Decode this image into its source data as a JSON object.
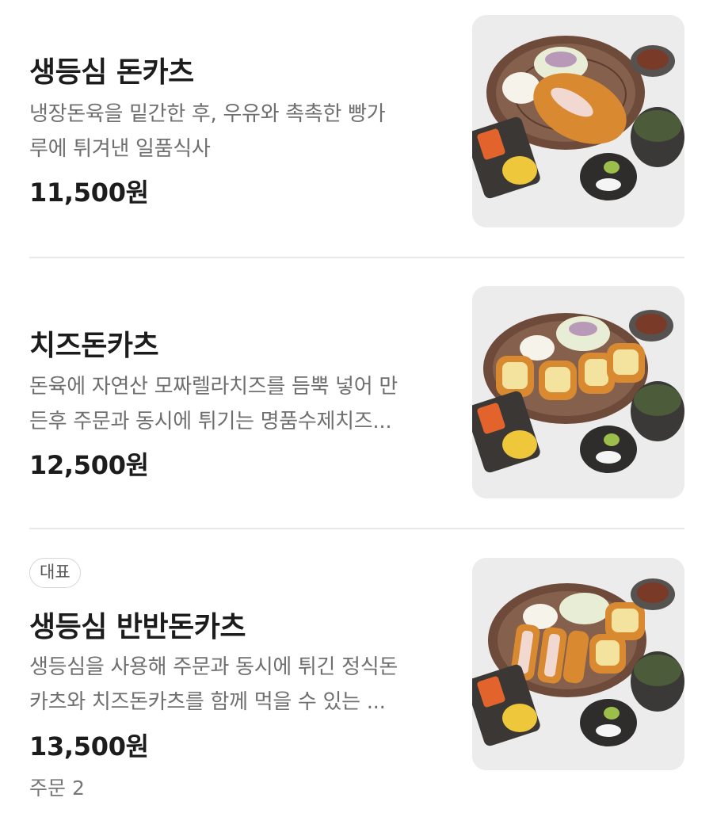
{
  "menu": {
    "items": [
      {
        "name": "생등심 돈카츠",
        "description_lines": [
          "냉장돈육을 밑간한 후, 우유와 촉촉한 빵가",
          "루에 튀겨낸 일품식사"
        ],
        "price": "11,500원",
        "image_icon": "pork-cutlet-set-photo"
      },
      {
        "name": "치즈돈카츠",
        "description_lines": [
          "돈육에 자연산 모짜렐라치즈를 듬뿍 넣어 만",
          "든후 주문과 동시에 튀기는 명품수제치즈..."
        ],
        "price": "12,500원",
        "image_icon": "cheese-cutlet-set-photo"
      },
      {
        "badge": "대표",
        "name": "생등심 반반돈카츠",
        "description_lines": [
          "생등심을 사용해 주문과 동시에 튀긴 정식돈",
          "카츠와 치즈돈카츠를 함께 먹을 수 있는 ..."
        ],
        "price": "13,500원",
        "orders": "주문 2",
        "image_icon": "half-half-cutlet-set-photo"
      }
    ]
  },
  "colors": {
    "title": "#1c1c1c",
    "description": "#6f6f6f",
    "divider": "#e8e8e8",
    "photo_background": "#ebebeb",
    "cutlet": "#d98a3a",
    "plate": "#6e4a3a"
  }
}
